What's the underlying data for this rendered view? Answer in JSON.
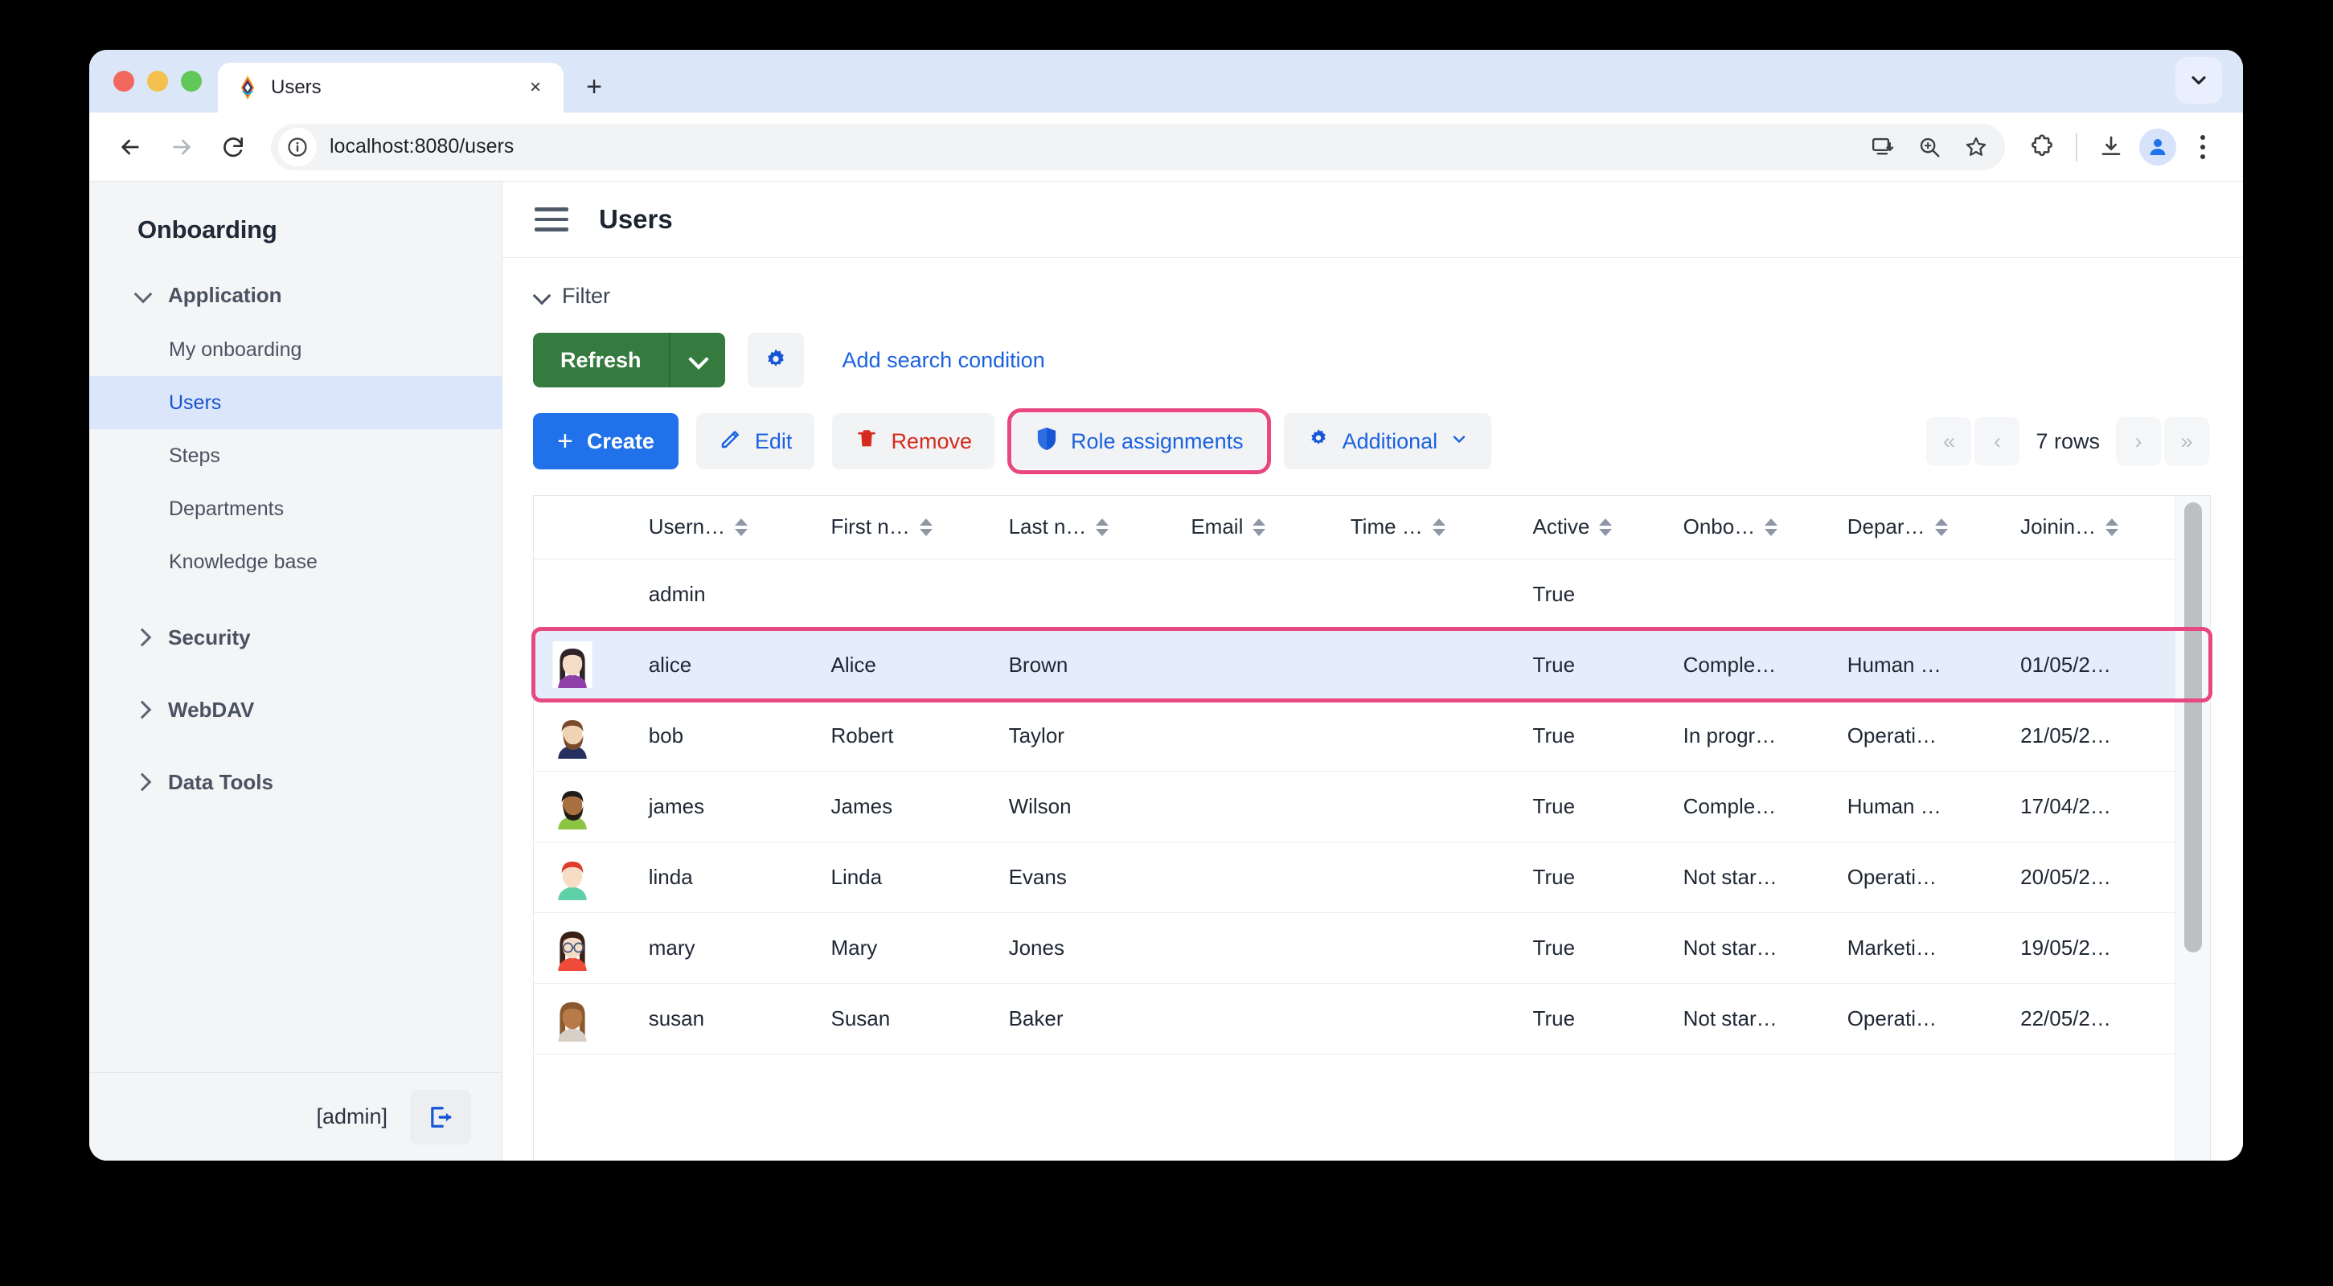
{
  "browser": {
    "tab": {
      "title": "Users",
      "favicon": "jmix-logo-icon",
      "close": "×"
    },
    "new_tab_label": "+",
    "tablist_chevron": "chevron-down-icon",
    "nav": {
      "back": "←",
      "forward": "→",
      "reload": "↻"
    },
    "omnibox": {
      "url": "localhost:8080/users",
      "info_icon": "info-circle-icon",
      "actions": [
        "install-app-icon",
        "zoom-icon",
        "bookmark-star-icon"
      ]
    },
    "toolbar_icons": [
      "extensions-puzzle-icon",
      "downloads-icon",
      "profile-avatar-icon",
      "browser-menu-icon"
    ]
  },
  "sidebar": {
    "brand": "Onboarding",
    "groups": [
      {
        "label": "Application",
        "expanded": true,
        "items": [
          {
            "label": "My onboarding",
            "active": false
          },
          {
            "label": "Users",
            "active": true
          },
          {
            "label": "Steps",
            "active": false
          },
          {
            "label": "Departments",
            "active": false
          },
          {
            "label": "Knowledge base",
            "active": false
          }
        ]
      },
      {
        "label": "Security",
        "expanded": false,
        "items": []
      },
      {
        "label": "WebDAV",
        "expanded": false,
        "items": []
      },
      {
        "label": "Data Tools",
        "expanded": false,
        "items": []
      }
    ],
    "footer": {
      "user": "[admin]",
      "logout_icon": "logout-icon"
    }
  },
  "header": {
    "menu_icon": "hamburger-icon",
    "title": "Users"
  },
  "filter": {
    "label": "Filter",
    "caret": "chevron-down-icon"
  },
  "toolbar": {
    "refresh_label": "Refresh",
    "refresh_caret": "chevron-down-icon",
    "settings_icon": "gear-icon",
    "add_search_condition": "Add search condition"
  },
  "actions": {
    "create": {
      "label": "Create",
      "icon": "plus-icon"
    },
    "edit": {
      "label": "Edit",
      "icon": "pencil-icon"
    },
    "remove": {
      "label": "Remove",
      "icon": "trash-icon"
    },
    "role_assignments": {
      "label": "Role assignments",
      "icon": "shield-icon",
      "highlighted": true
    },
    "additional": {
      "label": "Additional",
      "icon": "gear-icon",
      "caret": "chevron-down-icon"
    }
  },
  "pagination": {
    "first": "«",
    "prev": "‹",
    "rows": "7 rows",
    "next": "›",
    "last": "»"
  },
  "table": {
    "columns": [
      {
        "key": "avatar",
        "label": "",
        "sortable": false
      },
      {
        "key": "username",
        "label": "Usern…",
        "sortable": true
      },
      {
        "key": "firstName",
        "label": "First n…",
        "sortable": true
      },
      {
        "key": "lastName",
        "label": "Last n…",
        "sortable": true
      },
      {
        "key": "email",
        "label": "Email",
        "sortable": true
      },
      {
        "key": "timeZone",
        "label": "Time …",
        "sortable": true
      },
      {
        "key": "active",
        "label": "Active",
        "sortable": true
      },
      {
        "key": "onboarding",
        "label": "Onbo…",
        "sortable": true
      },
      {
        "key": "department",
        "label": "Depar…",
        "sortable": true
      },
      {
        "key": "joining",
        "label": "Joinin…",
        "sortable": true
      }
    ],
    "rows": [
      {
        "avatar": null,
        "username": "admin",
        "firstName": "",
        "lastName": "",
        "email": "",
        "timeZone": "",
        "active": "True",
        "onboarding": "",
        "department": "",
        "joining": "",
        "selected": false
      },
      {
        "avatar": "avatar-alice",
        "username": "alice",
        "firstName": "Alice",
        "lastName": "Brown",
        "email": "",
        "timeZone": "",
        "active": "True",
        "onboarding": "Comple…",
        "department": "Human …",
        "joining": "01/05/2…",
        "selected": true
      },
      {
        "avatar": "avatar-bob",
        "username": "bob",
        "firstName": "Robert",
        "lastName": "Taylor",
        "email": "",
        "timeZone": "",
        "active": "True",
        "onboarding": "In progr…",
        "department": "Operati…",
        "joining": "21/05/2…",
        "selected": false
      },
      {
        "avatar": "avatar-james",
        "username": "james",
        "firstName": "James",
        "lastName": "Wilson",
        "email": "",
        "timeZone": "",
        "active": "True",
        "onboarding": "Comple…",
        "department": "Human …",
        "joining": "17/04/2…",
        "selected": false
      },
      {
        "avatar": "avatar-linda",
        "username": "linda",
        "firstName": "Linda",
        "lastName": "Evans",
        "email": "",
        "timeZone": "",
        "active": "True",
        "onboarding": "Not star…",
        "department": "Operati…",
        "joining": "20/05/2…",
        "selected": false
      },
      {
        "avatar": "avatar-mary",
        "username": "mary",
        "firstName": "Mary",
        "lastName": "Jones",
        "email": "",
        "timeZone": "",
        "active": "True",
        "onboarding": "Not star…",
        "department": "Marketi…",
        "joining": "19/05/2…",
        "selected": false
      },
      {
        "avatar": "avatar-susan",
        "username": "susan",
        "firstName": "Susan",
        "lastName": "Baker",
        "email": "",
        "timeZone": "",
        "active": "True",
        "onboarding": "Not star…",
        "department": "Operati…",
        "joining": "22/05/2…",
        "selected": false
      }
    ]
  },
  "colors": {
    "accent_blue": "#1a62e0",
    "primary_blue": "#2071ea",
    "refresh_green": "#357a3e",
    "danger_red": "#d52b1e",
    "highlight_pink": "#e8477f",
    "selected_row": "#e4edf9",
    "sidebar_bg": "#f4f5f7",
    "nav_active_bg": "#dbe6fa"
  }
}
